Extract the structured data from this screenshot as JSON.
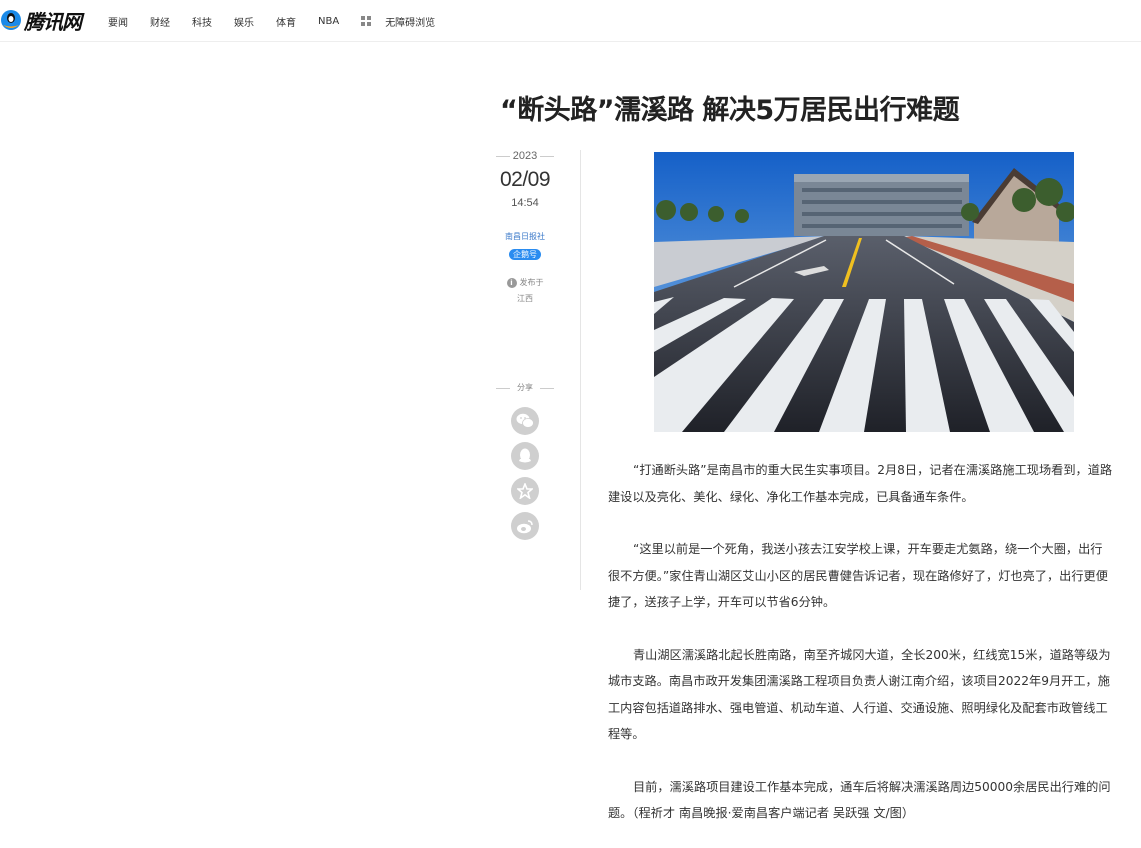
{
  "header": {
    "logo_text": "腾讯网",
    "nav": [
      "要闻",
      "财经",
      "科技",
      "娱乐",
      "体育",
      "NBA"
    ],
    "accessibility": "无障碍浏览"
  },
  "article": {
    "title": "“断头路”濡溪路 解决5万居民出行难题",
    "meta": {
      "year": "2023",
      "date": "02/09",
      "time": "14:54",
      "source": "南昌日报社",
      "badge": "企鹅号",
      "published_label": "发布于",
      "location": "江西"
    },
    "share_label": "分享",
    "share_icons": [
      "wechat-icon",
      "qq-icon",
      "favorite-icon",
      "weibo-icon"
    ],
    "paragraphs": [
      "“打通断头路”是南昌市的重大民生实事项目。2月8日，记者在濡溪路施工现场看到，道路建设以及亮化、美化、绿化、净化工作基本完成，已具备通车条件。",
      "“这里以前是一个死角，我送小孩去江安学校上课，开车要走尤氨路，绕一个大圈，出行很不方便。”家住青山湖区艾山小区的居民曹健告诉记者，现在路修好了，灯也亮了，出行更便捷了，送孩子上学，开车可以节省6分钟。",
      "青山湖区濡溪路北起长胜南路，南至齐城冈大道，全长200米，红线宽15米，道路等级为城市支路。南昌市政开发集团濡溪路工程项目负责人谢江南介绍，该项目2022年9月开工，施工内容包括道路排水、强电管道、机动车道、人行道、交通设施、照明绿化及配套市政管线工程等。",
      "目前，濡溪路项目建设工作基本完成，通车后将解决濡溪路周边50000余居民出行难的问题。（程祈才 南昌晚报·爱南昌客户端记者 吴跃强 文/图）"
    ]
  },
  "colors": {
    "accent_blue": "#2a8cf0",
    "source_blue": "#3a78c9",
    "share_gray": "#cfcfcf"
  }
}
